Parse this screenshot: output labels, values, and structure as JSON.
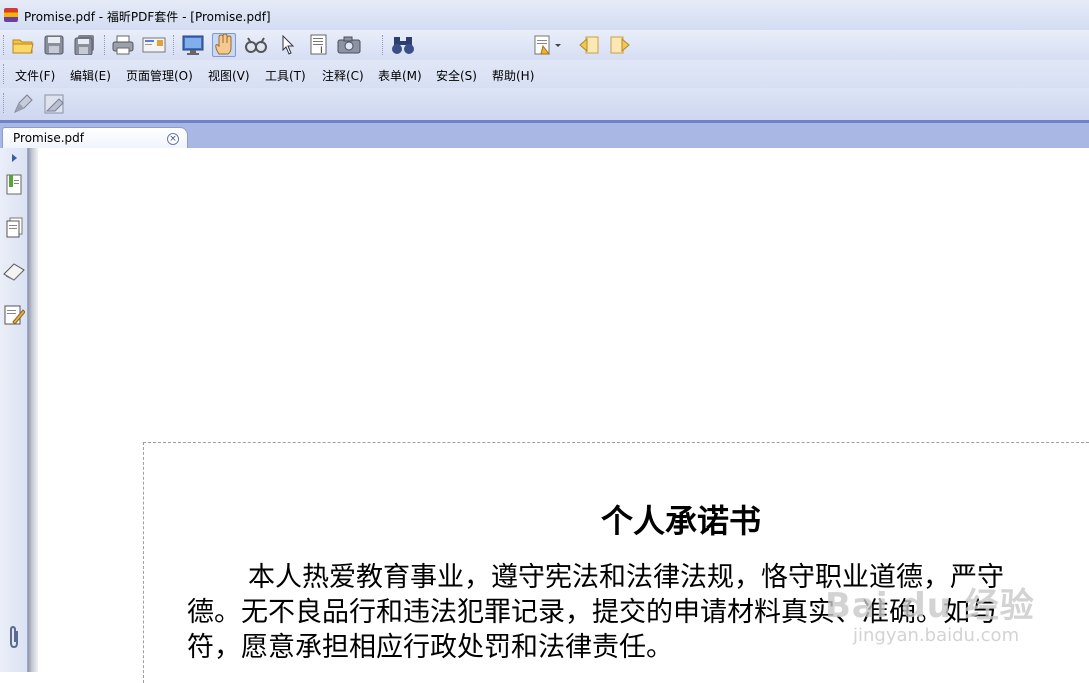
{
  "window": {
    "title": "Promise.pdf - 福昕PDF套件 - [Promise.pdf]"
  },
  "toolbar": {
    "icons": [
      "open-folder-icon",
      "save-icon",
      "save-all-icon",
      "print-icon",
      "email-icon",
      "monitor-icon",
      "hand-icon",
      "zoom-glasses-icon",
      "select-cursor-icon",
      "text-select-icon",
      "snapshot-camera-icon",
      "find-binoculars-icon",
      "search-options-icon",
      "prev-result-icon",
      "next-result-icon"
    ],
    "search": {
      "value": "",
      "placeholder": ""
    }
  },
  "menu": {
    "items": [
      "文件(F)",
      "编辑(E)",
      "页面管理(O)",
      "视图(V)",
      "工具(T)",
      "注释(C)",
      "表单(M)",
      "安全(S)",
      "帮助(H)"
    ]
  },
  "toolbar2": {
    "icons": [
      "highlight-pen-icon",
      "eraser-icon"
    ]
  },
  "tabs": [
    {
      "label": "Promise.pdf",
      "close": "×"
    }
  ],
  "sidebar": {
    "icons": [
      "expand-arrow-icon",
      "bookmarks-icon",
      "pages-icon",
      "layers-icon",
      "signature-icon",
      "attachment-icon"
    ]
  },
  "document": {
    "title": "个人承诺书",
    "lines": [
      "本人热爱教育事业，遵守宪法和法律法规，恪守职业道德，严守",
      "德。无不良品行和违法犯罪记录，提交的申请材料真实、准确。如与",
      "符，愿意承担相应行政处罚和法律责任。"
    ]
  },
  "watermark": {
    "main": "Bai du 经验",
    "sub": "jingyan.baidu.com"
  }
}
